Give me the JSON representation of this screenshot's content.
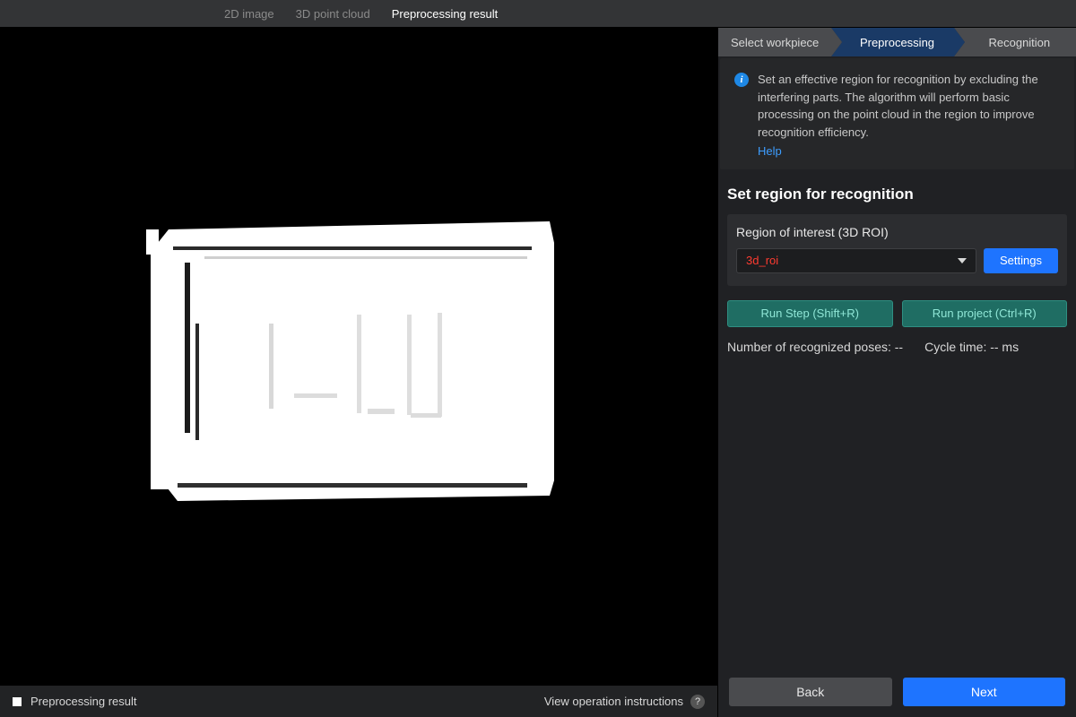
{
  "topTabs": {
    "t0": "2D image",
    "t1": "3D point cloud",
    "t2": "Preprocessing result"
  },
  "viewerFooter": {
    "title": "Preprocessing result",
    "instructions": "View operation instructions",
    "qmark": "?"
  },
  "steps": {
    "s0": "Select workpiece",
    "s1": "Preprocessing",
    "s2": "Recognition"
  },
  "info": {
    "icon": "i",
    "text": "Set an effective region for recognition by excluding the interfering parts. The algorithm will perform basic processing on the point cloud in the region to improve recognition efficiency.",
    "help": "Help"
  },
  "section": {
    "title": "Set region for recognition"
  },
  "roi": {
    "label": "Region of interest (3D ROI)",
    "value": "3d_roi",
    "settings": "Settings"
  },
  "run": {
    "step": "Run Step (Shift+R)",
    "project": "Run project (Ctrl+R)"
  },
  "stats": {
    "posesLabel": "Number of recognized poses: --",
    "cycleLabel": "Cycle time: -- ms"
  },
  "nav": {
    "back": "Back",
    "next": "Next"
  }
}
